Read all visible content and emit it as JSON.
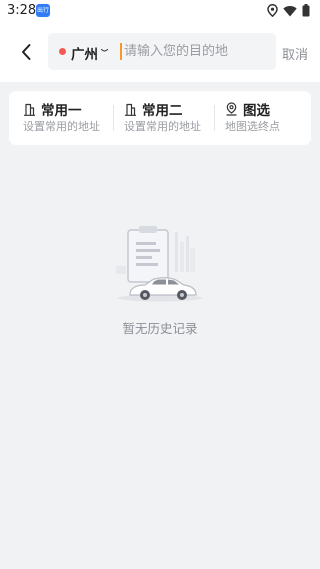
{
  "status_bar": {
    "time": "3:28",
    "app_icon_label": "出行",
    "icons": [
      "location-icon",
      "wifi-icon",
      "battery-icon"
    ]
  },
  "header": {
    "back_icon": "chevron-left-icon",
    "city": "广州",
    "destination_placeholder": "请输入您的目的地",
    "cancel_label": "取消"
  },
  "quick_links": [
    {
      "icon": "building-icon",
      "title": "常用一",
      "subtitle": "设置常用的地址"
    },
    {
      "icon": "building-icon",
      "title": "常用二",
      "subtitle": "设置常用的地址"
    },
    {
      "icon": "map-pin-icon",
      "title": "图选",
      "subtitle": "地图选终点"
    }
  ],
  "empty_state": {
    "illustration": "clipboard-car-illustration",
    "text": "暂无历史记录"
  },
  "colors": {
    "accent_dot": "#f25a52",
    "cursor": "#f29a2e",
    "background": "#f1f2f4"
  }
}
